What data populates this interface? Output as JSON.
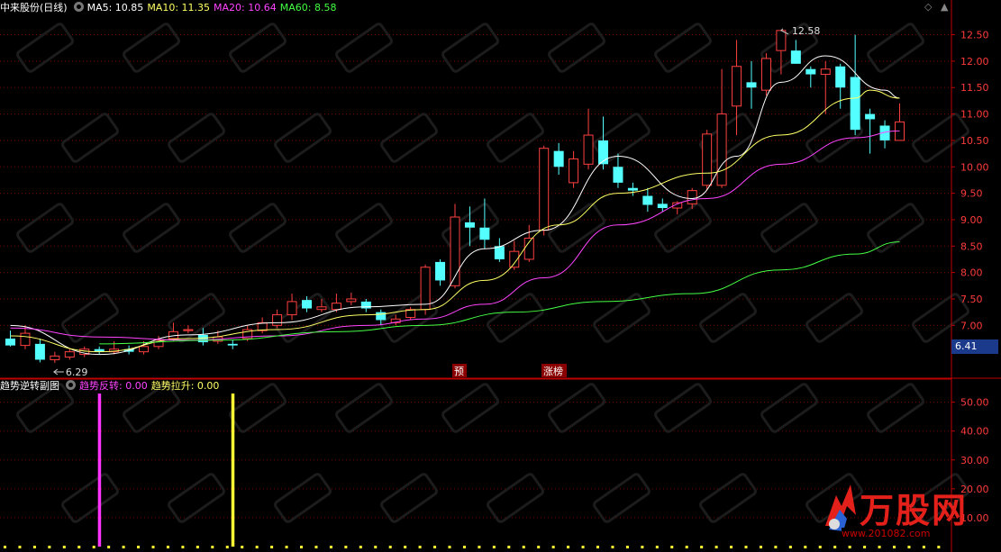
{
  "header": {
    "title": "中来股份(日线)",
    "ma5": "MA5: 10.85",
    "ma10": "MA10: 11.35",
    "ma20": "MA20: 10.64",
    "ma60": "MA60: 8.58"
  },
  "sub_header": {
    "title": "趋势逆转副图",
    "reversal": "趋势反转: 0.00",
    "rise": "趋势拉升: 0.00"
  },
  "top_controls": {
    "diamond": "◇",
    "up": "▲"
  },
  "annotations": {
    "high_label": "12.58",
    "low_label": "6.29",
    "marker_yu": "预",
    "marker_zhangbang": "涨榜"
  },
  "current_price": "6.41",
  "logo": {
    "main": "万股网",
    "sub": "www.201082.com"
  },
  "colors": {
    "up": "#ff4040",
    "down": "#54ffff",
    "ma5": "#ffffff",
    "ma10": "#ffff66",
    "ma20": "#ff44ff",
    "ma60": "#44ff44",
    "axis": "#c00000",
    "reversal_bar": "#ff33ff",
    "rise_bar": "#ffff33"
  },
  "chart_data": [
    {
      "type": "candlestick",
      "y_ticks": [
        "7.00",
        "7.50",
        "8.00",
        "8.50",
        "9.00",
        "9.50",
        "10.00",
        "10.50",
        "11.00",
        "11.50",
        "12.00",
        "12.50"
      ],
      "ylim": [
        6.0,
        12.85
      ],
      "candles": [
        [
          6.75,
          6.62,
          6.9,
          6.6
        ],
        [
          6.62,
          6.85,
          7.0,
          6.55
        ],
        [
          6.65,
          6.35,
          6.75,
          6.3
        ],
        [
          6.35,
          6.42,
          6.5,
          6.29
        ],
        [
          6.4,
          6.5,
          6.55,
          6.35
        ],
        [
          6.45,
          6.55,
          6.6,
          6.4
        ],
        [
          6.55,
          6.5,
          6.6,
          6.45
        ],
        [
          6.5,
          6.55,
          6.7,
          6.45
        ],
        [
          6.55,
          6.5,
          6.62,
          6.45
        ],
        [
          6.5,
          6.6,
          6.7,
          6.45
        ],
        [
          6.6,
          6.72,
          6.8,
          6.55
        ],
        [
          6.75,
          6.88,
          7.05,
          6.7
        ],
        [
          6.9,
          6.92,
          7.0,
          6.85
        ],
        [
          6.82,
          6.68,
          6.95,
          6.62
        ],
        [
          6.7,
          6.78,
          6.9,
          6.65
        ],
        [
          6.65,
          6.62,
          6.72,
          6.55
        ],
        [
          6.75,
          6.92,
          7.0,
          6.7
        ],
        [
          6.9,
          7.05,
          7.15,
          6.85
        ],
        [
          7.0,
          7.2,
          7.3,
          6.95
        ],
        [
          7.2,
          7.45,
          7.6,
          7.1
        ],
        [
          7.48,
          7.32,
          7.55,
          7.25
        ],
        [
          7.3,
          7.35,
          7.5,
          7.25
        ],
        [
          7.3,
          7.42,
          7.6,
          7.25
        ],
        [
          7.45,
          7.5,
          7.62,
          7.38
        ],
        [
          7.45,
          7.32,
          7.5,
          7.25
        ],
        [
          7.25,
          7.1,
          7.3,
          7.0
        ],
        [
          7.05,
          7.12,
          7.2,
          7.0
        ],
        [
          7.15,
          7.3,
          7.35,
          7.1
        ],
        [
          7.3,
          8.1,
          8.15,
          7.2
        ],
        [
          8.2,
          7.85,
          8.25,
          7.75
        ],
        [
          7.75,
          9.05,
          9.3,
          7.7
        ],
        [
          8.95,
          8.85,
          9.25,
          8.5
        ],
        [
          8.85,
          8.62,
          9.4,
          8.45
        ],
        [
          8.5,
          8.25,
          8.65,
          8.2
        ],
        [
          8.1,
          8.4,
          8.6,
          8.05
        ],
        [
          8.25,
          8.65,
          8.9,
          8.2
        ],
        [
          8.8,
          10.35,
          10.4,
          8.7
        ],
        [
          10.3,
          10.0,
          10.45,
          9.85
        ],
        [
          9.7,
          10.15,
          10.3,
          9.6
        ],
        [
          10.05,
          10.6,
          11.1,
          9.95
        ],
        [
          10.5,
          10.05,
          10.95,
          9.95
        ],
        [
          10.0,
          9.7,
          10.25,
          9.6
        ],
        [
          9.6,
          9.55,
          9.7,
          9.45
        ],
        [
          9.45,
          9.28,
          9.6,
          9.15
        ],
        [
          9.3,
          9.22,
          9.4,
          9.15
        ],
        [
          9.22,
          9.32,
          9.35,
          9.1
        ],
        [
          9.3,
          9.55,
          9.6,
          9.2
        ],
        [
          9.65,
          10.62,
          10.7,
          9.55
        ],
        [
          9.65,
          11.0,
          11.85,
          9.6
        ],
        [
          11.15,
          11.9,
          12.4,
          10.6
        ],
        [
          11.6,
          11.5,
          12.0,
          11.1
        ],
        [
          11.45,
          12.05,
          12.15,
          11.35
        ],
        [
          12.2,
          12.58,
          12.58,
          11.75
        ],
        [
          12.2,
          11.95,
          12.4,
          11.95
        ],
        [
          11.85,
          11.75,
          11.9,
          11.5
        ],
        [
          11.75,
          11.85,
          12.0,
          11.0
        ],
        [
          11.9,
          11.5,
          11.95,
          11.1
        ],
        [
          11.7,
          10.7,
          12.5,
          10.6
        ],
        [
          11.0,
          10.9,
          11.1,
          10.25
        ],
        [
          10.78,
          10.5,
          10.88,
          10.35
        ],
        [
          10.5,
          10.85,
          11.2,
          10.5
        ]
      ],
      "ma": {
        "ma5": [
          [
            0,
            7.0
          ],
          [
            6,
            6.45
          ],
          [
            12,
            6.82
          ],
          [
            18,
            7.05
          ],
          [
            24,
            7.35
          ],
          [
            28,
            7.4
          ],
          [
            32,
            8.45
          ],
          [
            36,
            8.8
          ],
          [
            41,
            10.2
          ],
          [
            46,
            9.4
          ],
          [
            49,
            10.2
          ],
          [
            52,
            11.6
          ],
          [
            55,
            12.1
          ],
          [
            59,
            11.45
          ],
          [
            60,
            11.3
          ]
        ],
        "ma10": [
          [
            0,
            6.8
          ],
          [
            6,
            6.5
          ],
          [
            12,
            6.75
          ],
          [
            18,
            6.92
          ],
          [
            24,
            7.2
          ],
          [
            28,
            7.3
          ],
          [
            32,
            7.85
          ],
          [
            37,
            8.9
          ],
          [
            41,
            9.5
          ],
          [
            47,
            9.88
          ],
          [
            52,
            10.6
          ],
          [
            57,
            11.3
          ],
          [
            58,
            11.45
          ],
          [
            60,
            11.3
          ]
        ],
        "ma20": [
          [
            0,
            6.95
          ],
          [
            6,
            6.78
          ],
          [
            12,
            6.72
          ],
          [
            18,
            6.8
          ],
          [
            24,
            7.0
          ],
          [
            28,
            7.12
          ],
          [
            32,
            7.4
          ],
          [
            36,
            7.9
          ],
          [
            41,
            8.9
          ],
          [
            47,
            9.4
          ],
          [
            52,
            10.05
          ],
          [
            57,
            10.55
          ],
          [
            60,
            10.68
          ]
        ],
        "ma60": [
          [
            6,
            6.65
          ],
          [
            14,
            6.72
          ],
          [
            22,
            6.88
          ],
          [
            28,
            7.0
          ],
          [
            34,
            7.25
          ],
          [
            40,
            7.45
          ],
          [
            46,
            7.6
          ],
          [
            52,
            8.05
          ],
          [
            57,
            8.35
          ],
          [
            60,
            8.58
          ]
        ]
      }
    },
    {
      "type": "bar",
      "name_reversal": "趋势反转",
      "name_rise": "趋势拉升",
      "y_ticks": [
        "10.00",
        "20.00",
        "30.00",
        "40.00",
        "50.00"
      ],
      "ylim": [
        0,
        53
      ],
      "signals": [
        {
          "series": "reversal",
          "index": 6,
          "value": 53
        },
        {
          "series": "rise",
          "index": 15,
          "value": 53
        }
      ]
    }
  ]
}
